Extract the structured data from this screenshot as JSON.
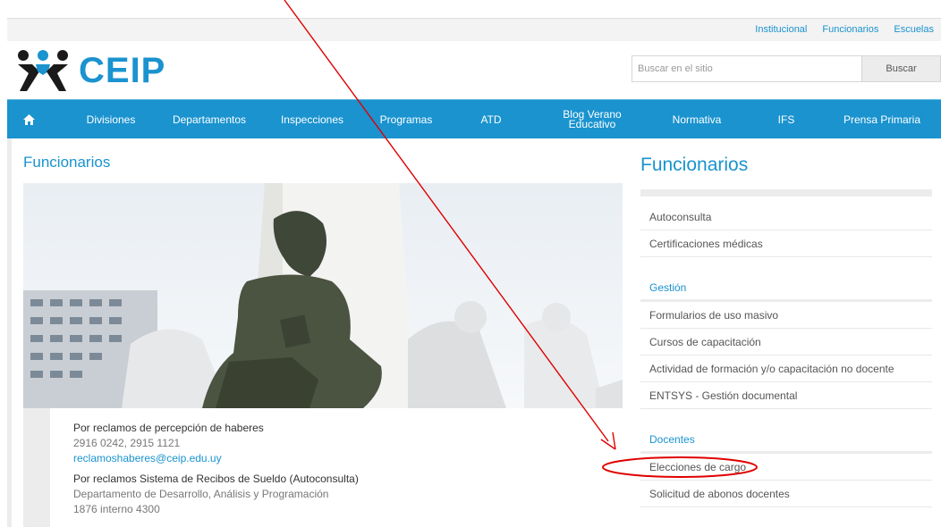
{
  "top_links": [
    "Institucional",
    "Funcionarios",
    "Escuelas"
  ],
  "logo": {
    "text": "CEIP"
  },
  "search": {
    "placeholder": "Buscar en el sitio",
    "button": "Buscar"
  },
  "nav": {
    "home_icon": "home-icon",
    "items": [
      "Divisiones",
      "Departamentos",
      "Inspecciones",
      "Programas",
      "ATD",
      "Blog Verano Educativo",
      "Normativa",
      "IFS",
      "Prensa Primaria"
    ]
  },
  "main": {
    "title": "Funcionarios",
    "contacts": [
      {
        "title": "Por reclamos de percepción de haberes",
        "line": "2916 0242, 2915 1121",
        "email": "reclamoshaberes@ceip.edu.uy"
      },
      {
        "title": "Por reclamos Sistema de Recibos de Sueldo (Autoconsulta)",
        "line": "Departamento de Desarrollo, Análisis y Programación",
        "line2": "1876 interno 4300"
      }
    ]
  },
  "sidebar": {
    "title": "Funcionarios",
    "top_items": [
      "Autoconsulta",
      "Certificaciones médicas"
    ],
    "gestion": {
      "heading": "Gestión",
      "items": [
        "Formularios de uso masivo",
        "Cursos de capacitación",
        "Actividad de formación y/o capacitación no docente",
        "ENTSYS - Gestión documental"
      ]
    },
    "docentes": {
      "heading": "Docentes",
      "items": [
        "Elecciones de cargo",
        "Solicitud de abonos docentes"
      ]
    }
  },
  "annotation": {
    "color": "#e00000"
  }
}
